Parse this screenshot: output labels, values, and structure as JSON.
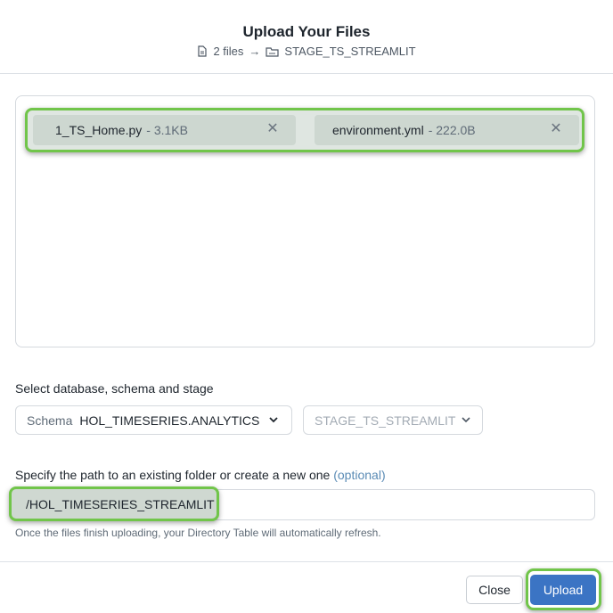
{
  "dialog": {
    "title": "Upload Your Files",
    "file_count": "2 files",
    "arrow": "→",
    "stage_target": "STAGE_TS_STREAMLIT"
  },
  "files": [
    {
      "name": "1_TS_Home.py",
      "size": "- 3.1KB",
      "remove": "✕"
    },
    {
      "name": "environment.yml",
      "size": "- 222.0B",
      "remove": "✕"
    }
  ],
  "location": {
    "label": "Select database, schema and stage",
    "schema_prefix": "Schema",
    "schema_value": "HOL_TIMESERIES.ANALYTICS",
    "stage_placeholder": "STAGE_TS_STREAMLIT"
  },
  "path": {
    "label": "Specify the path to an existing folder or create a new one",
    "optional": "(optional)",
    "value": "/HOL_TIMESERIES_STREAMLIT",
    "hint": "Once the files finish uploading, your Directory Table will automatically refresh."
  },
  "footer": {
    "close_label": "Close",
    "upload_label": "Upload"
  },
  "colors": {
    "highlight": "#71c54a",
    "primary": "#3b74c4",
    "optional_text": "#5a8bb5"
  }
}
